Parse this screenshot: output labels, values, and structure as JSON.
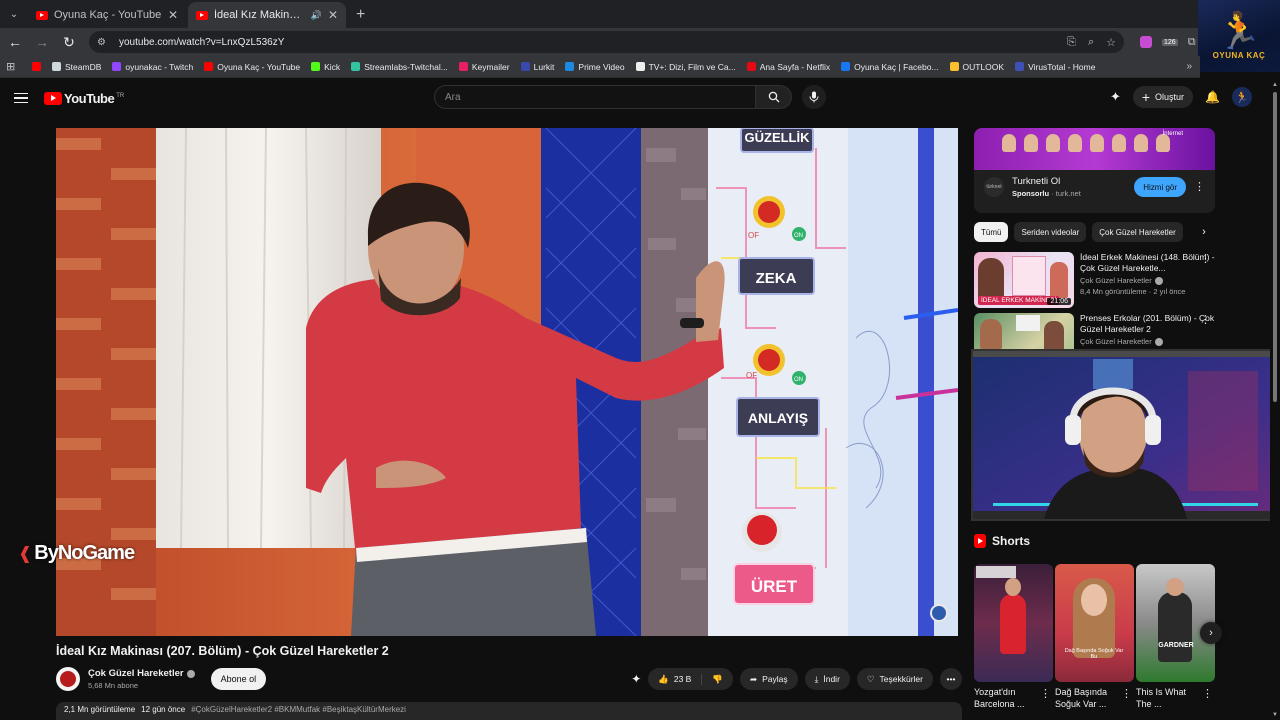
{
  "browser": {
    "tabs": [
      {
        "title": "Oyuna Kaç - YouTube",
        "active": false
      },
      {
        "title": "İdeal Kız Makinası (207. Bölüm)",
        "active": true
      }
    ],
    "url": "youtube.com/watch?v=LnxQzL536zY",
    "ext_badge": "126",
    "bookmarks": [
      {
        "label": "",
        "icon_color": "#ff0000"
      },
      {
        "label": "SteamDB",
        "icon_color": "#cfd8dc"
      },
      {
        "label": "oyunakac - Twitch",
        "icon_color": "#9146ff"
      },
      {
        "label": "Oyuna Kaç - YouTube",
        "icon_color": "#ff0000"
      },
      {
        "label": "Kick",
        "icon_color": "#53fc18"
      },
      {
        "label": "Streamlabs-Twitchal...",
        "icon_color": "#31c3a2"
      },
      {
        "label": "Keymailer",
        "icon_color": "#e91e63"
      },
      {
        "label": "Lurkit",
        "icon_color": "#3949ab"
      },
      {
        "label": "Prime Video",
        "icon_color": "#1e88e5"
      },
      {
        "label": "TV+: Dizi, Film ve Ca...",
        "icon_color": "#eeeeee"
      },
      {
        "label": "Ana Sayfa - Netflix",
        "icon_color": "#e50914"
      },
      {
        "label": "Oyuna Kaç | Facebo...",
        "icon_color": "#1877f2"
      },
      {
        "label": "OUTLOOK",
        "icon_color": "#fbc02d"
      },
      {
        "label": "VirusTotal - Home",
        "icon_color": "#3f51b5"
      }
    ],
    "bookmarks_more": "»",
    "corner_logo_label": "OYUNA KAÇ"
  },
  "masthead": {
    "logo": "YouTube",
    "country_code": "TR",
    "search_placeholder": "Ara",
    "create_label": "Oluştur"
  },
  "player": {
    "overlay_logo": "ByNoGame",
    "on_screen_signs": [
      "GÜZELLİK",
      "ZEKA",
      "ANLAYIŞ",
      "ÜRET"
    ],
    "switch_labels": [
      "OF",
      "ON"
    ]
  },
  "video": {
    "title": "İdeal Kız Makinası (207. Bölüm) - Çok Güzel Hareketler 2",
    "channel": "Çok Güzel Hareketler",
    "subscribers": "5,68 Mn abone",
    "subscribe_label": "Abone ol",
    "likes": "23 B",
    "share_label": "Paylaş",
    "download_label": "İndir",
    "thanks_label": "Teşekkürler",
    "views": "2,1 Mn görüntüleme",
    "age": "12 gün önce",
    "tags": "#ÇokGüzelHareketler2 #BKMMutfak #BeşiktaşKültürMerkezi"
  },
  "ad": {
    "banner_tag": "İnternet",
    "title": "Turknetli Ol",
    "sponsored": "Sponsorlu",
    "domain": "turk.net",
    "logo_text": "türknet",
    "cta": "Hizmi gör"
  },
  "chips": [
    "Tümü",
    "Seriden videolar",
    "Çok Güzel Hareketler"
  ],
  "recommendations": [
    {
      "title": "İdeal Erkek Makinesi (148. Bölüm) - Çok Güzel Hareketle...",
      "channel": "Çok Güzel Hareketler",
      "stats": "8,4 Mn görüntüleme · 2 yıl önce",
      "duration": "21:06",
      "thumb_caption": "İDEAL ERKEK MAKİNESİ"
    },
    {
      "title": "Prenses Erkolar (201. Bölüm) - Çok Güzel Hareketler 2",
      "channel": "Çok Güzel Hareketler",
      "stats": "",
      "duration": "",
      "thumb_caption": ""
    }
  ],
  "shorts": {
    "heading": "Shorts",
    "items": [
      {
        "title": "Yozgat'dın Barcelona ...",
        "caption": ""
      },
      {
        "title": "Dağ Başında Soğuk Var ...",
        "caption": "Dağ Başında Soğuk Var Bu"
      },
      {
        "title": "This Is What The ...",
        "caption": "GARDNER"
      }
    ]
  },
  "colors": {
    "accent_red": "#ff0000",
    "link_blue": "#3ea6ff",
    "background": "#0f0f0f"
  }
}
